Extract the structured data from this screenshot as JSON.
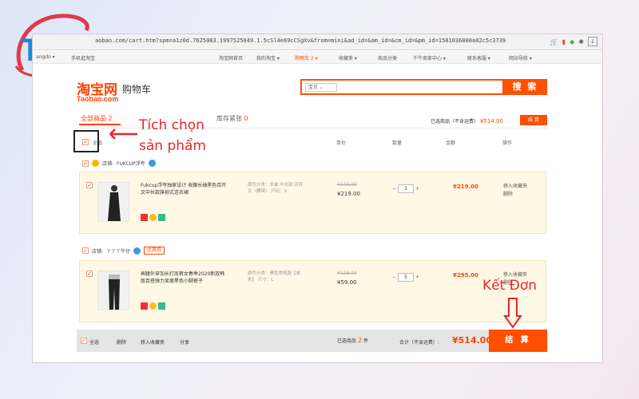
{
  "logo": {
    "text": "TG"
  },
  "browser": {
    "url": "aobao.com/cart.htm?spm=a1z0d.7625083.1997525049.1.5cSl4e69cCSgXv&from=mini&ad_id=&am_id=&cm_id=&pm_id=1501036000a02c5c3739"
  },
  "sitenav": {
    "left": [
      "angdo ▾",
      "手机逛淘宝"
    ],
    "right": [
      "淘宝网首页",
      "我的淘宝 ▾",
      "购物车 2 ▾",
      "收藏夹 ▾",
      "商品分类",
      "千牛卖家中心 ▾",
      "联系客服 ▾",
      "网站导航 ▾"
    ]
  },
  "header": {
    "logo_cn": "淘宝网",
    "logo_en": "Taobao.com",
    "title": "购物车",
    "search_scope": "宝贝",
    "search_button": "搜 索"
  },
  "tabs": {
    "all_label": "全部商品",
    "all_count": "2",
    "other_label": "库存紧张",
    "other_count": "0"
  },
  "summary_top": {
    "label": "已选商品（不含运费）",
    "price": "¥514.00",
    "button": "结 算"
  },
  "columns": {
    "select_all": "全选",
    "unit_price": "单价",
    "quantity": "数量",
    "amount": "金额",
    "ops": "操作"
  },
  "shops": [
    {
      "label": "店铺:",
      "name": "FUKCUP浮夸",
      "coupon": ""
    },
    {
      "label": "店铺:",
      "name": "丫丫丫牛仔",
      "coupon": "优惠券"
    }
  ],
  "items": [
    {
      "name": "Fukcup浮夸独家设计 收腰长袖黑色百开叉中长款旗袍式连衣裙",
      "props": "颜色分类：长袖 中长款 百开叉（腰袋） 尺码：S",
      "old_price": "¥249.00",
      "price": "¥219.00",
      "qty": "1",
      "total": "¥219.00",
      "op1": "移入收藏夹",
      "op2": "删除"
    },
    {
      "name": "高腰外穿加长打底裤女春季2020新款韩版百搭弹力显瘦黑色小脚裤子",
      "props": "颜色分类：黑色常规款【单条】 尺寸：L",
      "old_price": "¥128.00",
      "price": "¥59.00",
      "qty": "5",
      "total": "¥295.00",
      "op1": "移入收藏夹",
      "op2": "删除"
    }
  ],
  "bottom": {
    "select_all": "全选",
    "delete": "删除",
    "move_fav": "移入收藏夹",
    "share": "分享",
    "selected_label": "已选商品",
    "selected_count": "2",
    "selected_unit": "件",
    "total_label": "合计（不含运费）:",
    "total": "¥514.00",
    "checkout": "结 算"
  },
  "annotations": {
    "select_line1": "Tích chọn",
    "select_line2": "sản phẩm",
    "checkout": "Kết Đơn"
  },
  "colors": {
    "accent": "#ff5000",
    "annotation": "#e8262a",
    "item_bg": "#fff8e5"
  }
}
